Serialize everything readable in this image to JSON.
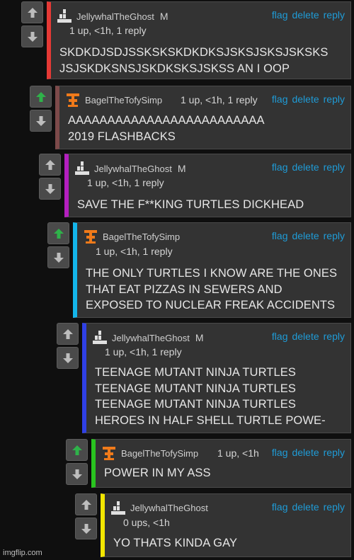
{
  "actions": {
    "flag": "flag",
    "delete": "delete",
    "reply": "reply"
  },
  "colors": {
    "accent": "#1f9bd6",
    "upvote_active": "#2fb24a",
    "bars": [
      "#e53935",
      "#7d4a4a",
      "#b41fbf",
      "#13b5ea",
      "#2f40e6",
      "#29c41f",
      "#f2e600"
    ]
  },
  "icons": {
    "up": "arrow-up-icon",
    "down": "arrow-down-icon",
    "ghost_avatar": "ghost-avatar-icon",
    "bagel_avatar": "bagel-avatar-icon"
  },
  "comments": [
    {
      "username": "JellywhalTheGhost",
      "badge": "M",
      "meta": "1 up, <1h, 1 reply",
      "upvoted": false,
      "lines": [
        "SKDKDJSDJSSKSKSKDKDKSJSKSJSKSJSKSKS",
        "JSJSKDKSNSJSKDKSKSJSKSS AN I OOP"
      ]
    },
    {
      "username": "BagelTheTofySimp",
      "badge": "",
      "meta": "1 up, <1h, 1 reply",
      "upvoted": true,
      "lines": [
        "AAAAAAAAAAAAAAAAAAAAAAAAA",
        "2019 FLASHBACKS"
      ]
    },
    {
      "username": "JellywhalTheGhost",
      "badge": "M",
      "meta": "1 up, <1h, 1 reply",
      "upvoted": false,
      "lines": [
        "SAVE THE F**KING TURTLES DICKHEAD"
      ]
    },
    {
      "username": "BagelTheTofySimp",
      "badge": "",
      "meta": "1 up, <1h, 1 reply",
      "upvoted": true,
      "lines": [
        "THE ONLY TURTLES I KNOW ARE THE ONES",
        "THAT EAT PIZZAS IN SEWERS AND",
        "EXPOSED TO NUCLEAR FREAK ACCIDENTS"
      ]
    },
    {
      "username": "JellywhalTheGhost",
      "badge": "M",
      "meta": "1 up, <1h, 1 reply",
      "upvoted": false,
      "lines": [
        "TEENAGE MUTANT NINJA TURTLES",
        "TEENAGE MUTANT NINJA TURTLES",
        "TEENAGE MUTANT NINJA TURTLES",
        "HEROES IN HALF SHELL TURTLE POWE-"
      ]
    },
    {
      "username": "BagelTheTofySimp",
      "badge": "",
      "meta": "1 up, <1h",
      "upvoted": true,
      "lines": [
        "POWER IN MY ASS"
      ]
    },
    {
      "username": "JellywhalTheGhost",
      "badge": "",
      "meta": "0 ups, <1h",
      "upvoted": false,
      "lines": [
        "YO THATS KINDA GAY"
      ]
    }
  ],
  "watermark": "imgflip.com"
}
